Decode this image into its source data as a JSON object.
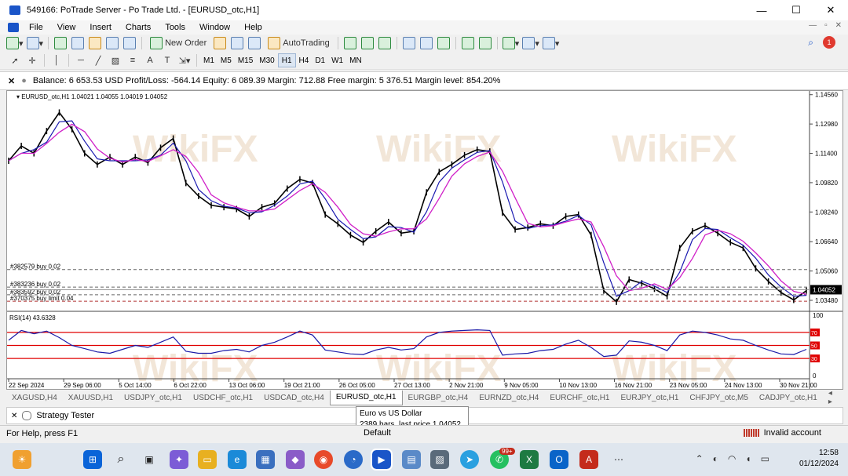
{
  "window": {
    "title": "549166: PoTrade Server - Po Trade Ltd. - [EURUSD_otc,H1]",
    "min": "—",
    "max": "☐",
    "close": "✕"
  },
  "menu": [
    "File",
    "View",
    "Insert",
    "Charts",
    "Tools",
    "Window",
    "Help"
  ],
  "toolbar": {
    "new_order": "New Order",
    "auto_trading": "AutoTrading"
  },
  "timeframes": [
    "M1",
    "M5",
    "M15",
    "M30",
    "H1",
    "H4",
    "D1",
    "W1",
    "MN"
  ],
  "active_timeframe": "H1",
  "account_bar": {
    "close": "✕",
    "text": "Balance: 6 653.53 USD  Profit/Loss: -564.14  Equity: 6 089.39  Margin: 712.88  Free margin: 5 376.51  Margin level: 854.20%"
  },
  "chart_data": {
    "type": "line",
    "header": "EURUSD_otc,H1  1.04021 1.04055 1.04019 1.04052",
    "watermark": "WikiFX",
    "price_axis": [
      "1.14560",
      "1.12980",
      "1.11400",
      "1.09820",
      "1.08240",
      "1.06640",
      "1.05060",
      "1.03480"
    ],
    "current_price": "1.04052",
    "ylim": [
      1.0293,
      1.1476
    ],
    "x_labels": [
      "22 Sep 2024",
      "29 Sep 06:00",
      "5 Oct 14:00",
      "6 Oct 22:00",
      "13 Oct 06:00",
      "19 Oct 21:00",
      "26 Oct 05:00",
      "27 Oct 13:00",
      "2 Nov 21:00",
      "9 Nov 05:00",
      "10 Nov 13:00",
      "16 Nov 21:00",
      "23 Nov 05:00",
      "24 Nov 13:00",
      "30 Nov 21:00"
    ],
    "price_series": [
      {
        "name": "",
        "values": [
          1.11,
          1.118,
          1.114,
          1.126,
          1.136,
          1.127,
          1.114,
          1.108,
          1.112,
          1.108,
          1.112,
          1.109,
          1.117,
          1.122,
          1.098,
          1.091,
          1.086,
          1.085,
          1.084,
          1.08,
          1.085,
          1.087,
          1.095,
          1.1,
          1.098,
          1.081,
          1.076,
          1.07,
          1.066,
          1.072,
          1.077,
          1.071,
          1.072,
          1.093,
          1.104,
          1.108,
          1.113,
          1.116,
          1.115,
          1.082,
          1.073,
          1.074,
          1.076,
          1.075,
          1.08,
          1.081,
          1.07,
          1.04,
          1.034,
          1.046,
          1.044,
          1.041,
          1.037,
          1.063,
          1.072,
          1.075,
          1.071,
          1.066,
          1.063,
          1.052,
          1.045,
          1.039,
          1.035,
          1.04
        ]
      }
    ],
    "orders": [
      {
        "label": "#382579 buy 0.02",
        "price": 1.0514,
        "color": "#666666"
      },
      {
        "label": "#383236 buy 0.02",
        "price": 1.0419,
        "color": "#666666"
      },
      {
        "label": "#383592 buy 0.02",
        "price": 1.0378,
        "color": "#666666"
      },
      {
        "label": "#370375 buy limit 0.04",
        "price": 1.0343,
        "color": "#b03030"
      }
    ],
    "rsi": {
      "label": "RSI(14) 43.6328",
      "levels": [
        "70",
        "50",
        "30"
      ],
      "axis": [
        "100",
        "0"
      ],
      "values": [
        58,
        73,
        68,
        72,
        62,
        50,
        45,
        40,
        38,
        44,
        50,
        47,
        55,
        63,
        41,
        38,
        38,
        42,
        44,
        40,
        50,
        55,
        63,
        72,
        66,
        43,
        40,
        37,
        36,
        43,
        47,
        43,
        45,
        63,
        70,
        72,
        73,
        74,
        73,
        35,
        37,
        38,
        42,
        44,
        52,
        58,
        47,
        33,
        35,
        57,
        55,
        50,
        42,
        66,
        72,
        70,
        66,
        60,
        58,
        50,
        43,
        37,
        36,
        44
      ]
    }
  },
  "symbol_tabs": [
    "XAGUSD,H4",
    "XAUUSD,H1",
    "USDJPY_otc,H1",
    "USDCHF_otc,H1",
    "USDCAD_otc,H4",
    "EURUSD_otc,H1",
    "EURGBP_otc,H4",
    "EURNZD_otc,H4",
    "EURCHF_otc,H1",
    "EURJPY_otc,H1",
    "CHFJPY_otc,M5",
    "CADJPY_otc,H1"
  ],
  "active_tab": "EURUSD_otc,H1",
  "strategy": {
    "close": "✕",
    "label": "Strategy Tester"
  },
  "tooltip": {
    "line1": "Euro vs US Dollar",
    "line2": "2389 bars, last price 1.04052"
  },
  "status": {
    "help": "For Help, press F1",
    "profile": "Default",
    "account": "Invalid account"
  },
  "tray": {
    "time": "12:58",
    "date": "01/12/2024",
    "badge": "99+"
  }
}
